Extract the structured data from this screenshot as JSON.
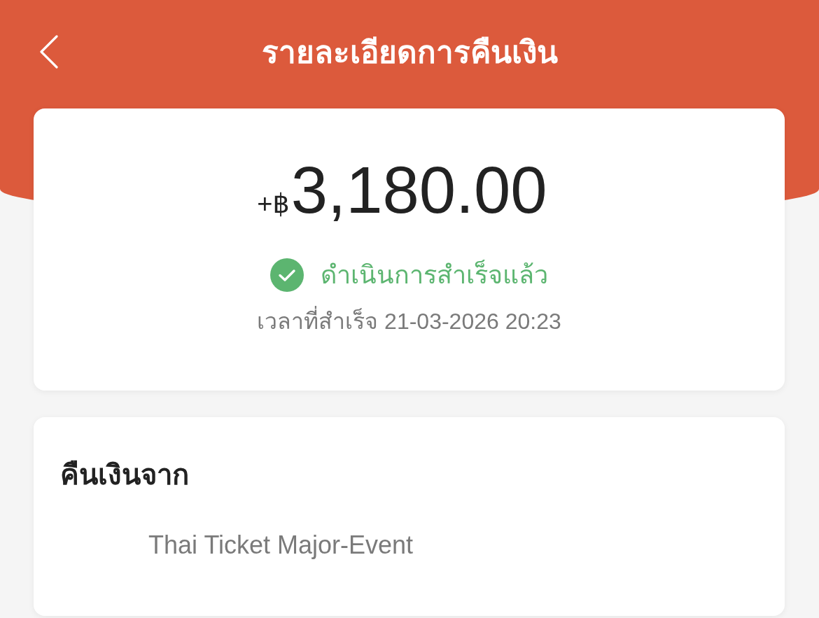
{
  "header": {
    "title": "รายละเอียดการคืนเงิน"
  },
  "summary": {
    "currency_prefix": "+฿",
    "amount": "3,180.00",
    "status": "ดำเนินการสำเร็จแล้ว",
    "completed_time": "เวลาที่สำเร็จ 21-03-2026 20:23"
  },
  "refund_source": {
    "heading": "คืนเงินจาก",
    "value": "Thai Ticket Major-Event"
  }
}
